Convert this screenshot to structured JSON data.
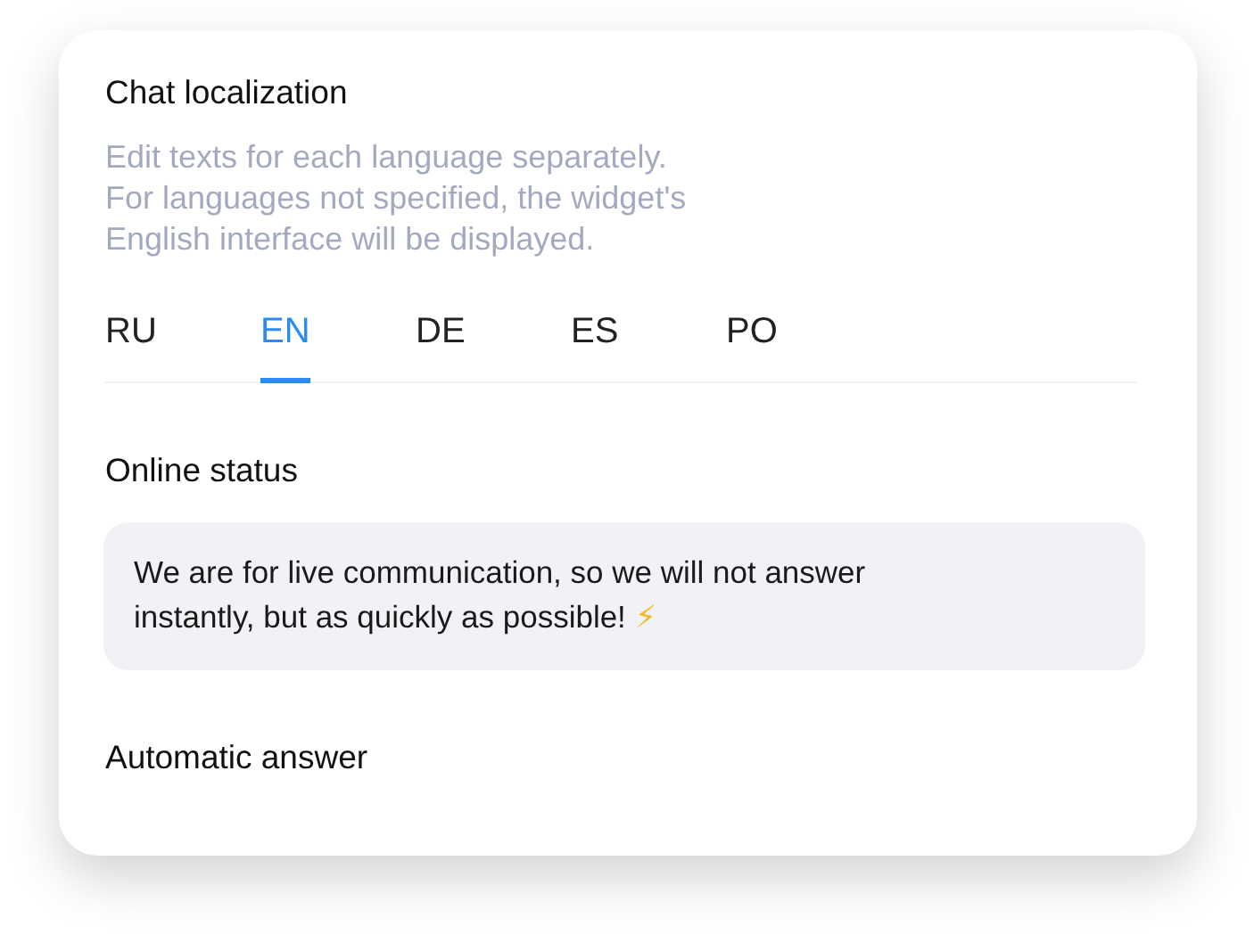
{
  "title": "Chat localization",
  "description": "Edit texts for each language separately.\nFor languages not specified, the widget's\nEnglish interface will be displayed.",
  "tabs": [
    {
      "label": "RU",
      "selected": false
    },
    {
      "label": "EN",
      "selected": true
    },
    {
      "label": "DE",
      "selected": false
    },
    {
      "label": "ES",
      "selected": false
    },
    {
      "label": "PO",
      "selected": false
    }
  ],
  "sections": [
    {
      "heading": "Online status",
      "message": "We are for live communication, so we will not answer\ninstantly, but as quickly as possible!",
      "emoji": "⚡"
    },
    {
      "heading": "Automatic answer"
    }
  ]
}
